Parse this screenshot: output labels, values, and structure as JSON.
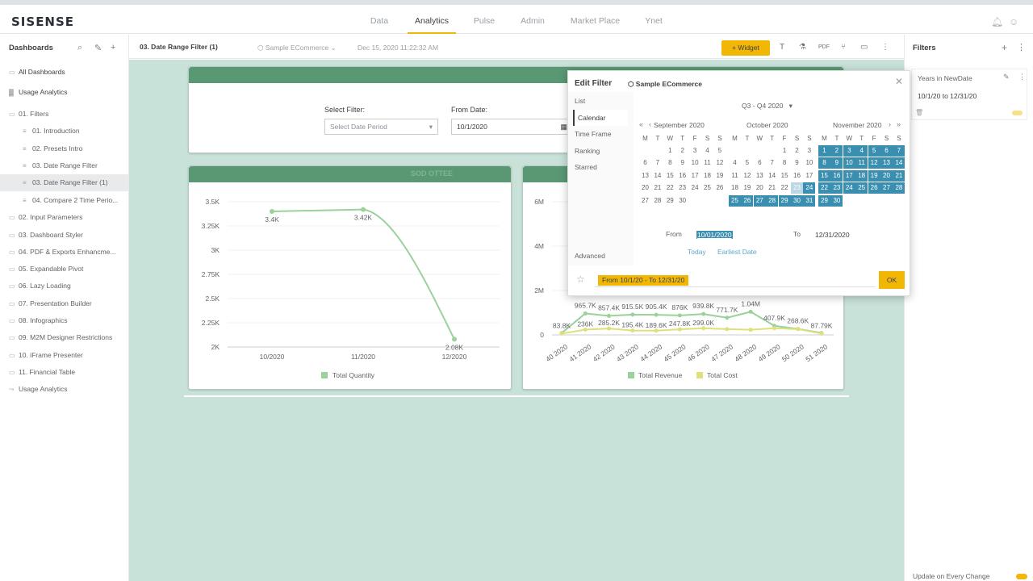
{
  "brand": "SISENSE",
  "nav": {
    "tabs": [
      "Data",
      "Analytics",
      "Pulse",
      "Admin",
      "Market Place",
      "Ynet"
    ],
    "active": "Analytics"
  },
  "left": {
    "title": "Dashboards",
    "items": [
      {
        "label": "All Dashboards",
        "level": 0,
        "icon": "folder-icon",
        "bold": true
      },
      {
        "label": "Usage Analytics",
        "level": 0,
        "icon": "chart-icon",
        "bold": true
      },
      {
        "label": "01. Filters",
        "level": 0,
        "icon": "folder-open-icon"
      },
      {
        "label": "01. Introduction",
        "level": 1,
        "icon": "dashboard-icon"
      },
      {
        "label": "02. Presets Intro",
        "level": 1,
        "icon": "dashboard-icon"
      },
      {
        "label": "03. Date Range Filter",
        "level": 1,
        "icon": "dashboard-icon"
      },
      {
        "label": "03. Date Range Filter (1)",
        "level": 1,
        "icon": "dashboard-icon",
        "selected": true
      },
      {
        "label": "04. Compare 2 Time Perio...",
        "level": 1,
        "icon": "dashboard-icon"
      },
      {
        "label": "02. Input Parameters",
        "level": 0,
        "icon": "folder-icon"
      },
      {
        "label": "03. Dashboard Styler",
        "level": 0,
        "icon": "folder-icon"
      },
      {
        "label": "04. PDF & Exports Enhancme...",
        "level": 0,
        "icon": "folder-icon"
      },
      {
        "label": "05. Expandable Pivot",
        "level": 0,
        "icon": "folder-icon"
      },
      {
        "label": "06. Lazy Loading",
        "level": 0,
        "icon": "folder-icon"
      },
      {
        "label": "07. Presentation Builder",
        "level": 0,
        "icon": "folder-icon"
      },
      {
        "label": "08. Infographics",
        "level": 0,
        "icon": "folder-icon"
      },
      {
        "label": "09. M2M Designer Restrictions",
        "level": 0,
        "icon": "folder-icon"
      },
      {
        "label": "10. iFrame Presenter",
        "level": 0,
        "icon": "folder-icon"
      },
      {
        "label": "11. Financial Table",
        "level": 0,
        "icon": "folder-icon"
      },
      {
        "label": "Usage Analytics",
        "level": 0,
        "icon": "share-icon"
      }
    ]
  },
  "toolbar": {
    "dashboard_title": "03. Date Range Filter (1)",
    "datasource": "Sample ECommerce",
    "timestamp": "Dec 15, 2020 11:22:32 AM",
    "widget_label": "Widget"
  },
  "filter_widget": {
    "select_label": "Select Filter:",
    "select_placeholder": "Select Date Period",
    "from_label": "From Date:",
    "from_value": "10/1/2020"
  },
  "chart1": {
    "header": "SOD OTTEE",
    "chart_data": {
      "type": "line",
      "categories": [
        "10/2020",
        "11/2020",
        "12/2020"
      ],
      "series": [
        {
          "name": "Total Quantity",
          "values": [
            3400,
            3420,
            2080
          ]
        }
      ],
      "value_labels": [
        "3.4K",
        "3.42K",
        "2.08K"
      ],
      "ylim": [
        2000,
        3500
      ],
      "yticks": [
        "2K",
        "2.25K",
        "2.5K",
        "2.75K",
        "3K",
        "3.25K",
        "3.5K"
      ],
      "legend": "bottom",
      "color": "#9bd19b"
    }
  },
  "chart2": {
    "chart_data": {
      "type": "line",
      "categories": [
        "40 2020",
        "41 2020",
        "42 2020",
        "43 2020",
        "44 2020",
        "45 2020",
        "46 2020",
        "47 2020",
        "48 2020",
        "49 2020",
        "50 2020",
        "51 2020"
      ],
      "yticks": [
        "0",
        "2M",
        "4M",
        "6M"
      ],
      "ylim": [
        0,
        6000000
      ],
      "series": [
        {
          "name": "Total Revenue",
          "color": "#9bd19b",
          "values": [
            83800,
            965700,
            857400,
            915500,
            905400,
            876000,
            939800,
            771700,
            1040000,
            407900,
            268600,
            87790
          ]
        },
        {
          "name": "Total Cost",
          "color": "#e0e07a",
          "values": [
            60000,
            236000,
            285200,
            195400,
            189600,
            247800,
            299000,
            260000,
            230000,
            299000,
            260000,
            60000
          ]
        }
      ],
      "value_labels": [
        "83.8K",
        "965.7K",
        "857.4K",
        "915.5K",
        "905.4K",
        "876K",
        "939.8K",
        "771.7K",
        "1.04M",
        "407.9K",
        "268.6K",
        "87.79K",
        "236K",
        "285.2K",
        "195.4K",
        "189.6K",
        "247.8K",
        "299.0K"
      ],
      "legend": "bottom"
    }
  },
  "modal": {
    "title": "Edit Filter",
    "datasource": "Sample ECommerce",
    "tabs": [
      "List",
      "Calendar",
      "Time Frame",
      "Ranking",
      "Starred"
    ],
    "active_tab": "Calendar",
    "advanced": "Advanced",
    "quarter": "Q3 - Q4 2020",
    "months": [
      {
        "name": "September",
        "year": "2020",
        "offset": 2,
        "days": 30,
        "sel_from": 0
      },
      {
        "name": "October",
        "year": "2020",
        "offset": 4,
        "days": 31,
        "sel_from": 24,
        "hover": 23
      },
      {
        "name": "November",
        "year": "2020",
        "offset": 0,
        "days": 30,
        "sel_from": 1
      }
    ],
    "dow": [
      "M",
      "T",
      "W",
      "T",
      "F",
      "S",
      "S"
    ],
    "from_label": "From",
    "from_value": "10/01/2020",
    "to_label": "To",
    "to_value": "12/31/2020",
    "today": "Today",
    "earliest": "Earliest Date",
    "summary": "From 10/1/20 - To 12/31/20",
    "ok": "OK"
  },
  "right": {
    "title": "Filters",
    "filter_name": "Years in NewDate",
    "filter_value": "10/1/20 to 12/31/20",
    "footer": "Update on Every Change"
  }
}
